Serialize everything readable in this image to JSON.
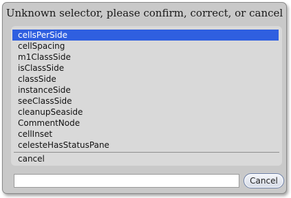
{
  "dialog": {
    "title": "Unknown selector, please confirm, correct, or cancel",
    "items": [
      "cellsPerSide",
      "cellSpacing",
      "m1ClassSide",
      "isClassSide",
      "classSide",
      "instanceSide",
      "seeClassSide",
      "cleanupSeaside",
      "CommentNode",
      "cellInset",
      "celesteHasStatusPane"
    ],
    "selected_index": 0,
    "cancel_item": "cancel",
    "input_value": "",
    "cancel_button": "Cancel"
  },
  "colors": {
    "selection": "#2f5fe0",
    "dialog_bg": "#c9c9c9",
    "list_bg": "#d9d9d9"
  }
}
